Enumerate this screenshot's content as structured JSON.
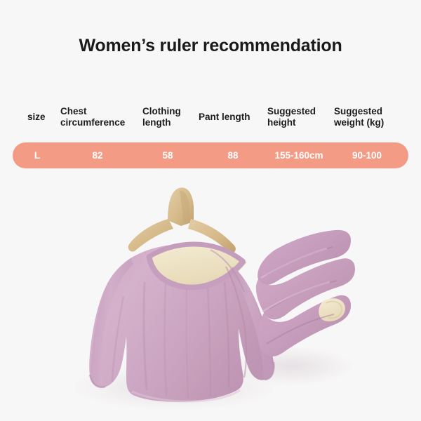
{
  "page": {
    "background_color": "#f8f7f7",
    "title": "Women’s ruler recommendation"
  },
  "size_table": {
    "accent_color": "#f49b85",
    "header_text_color": "#1d1d1d",
    "row_text_color": "#ffffff",
    "columns": [
      {
        "key": "size",
        "label": "size"
      },
      {
        "key": "chest",
        "label": "Chest circumference"
      },
      {
        "key": "clothing",
        "label": "Clothing length"
      },
      {
        "key": "pant",
        "label": "Pant length"
      },
      {
        "key": "height",
        "label": "Suggested height"
      },
      {
        "key": "weight",
        "label": "Suggested weight (kg)"
      }
    ],
    "headers": {
      "size": "size",
      "chest_line1": "Chest",
      "chest_line2": "circumference",
      "clothing_line1": "Clothing",
      "clothing_line2": "length",
      "pant": "Pant length",
      "height_line1": "Suggested",
      "height_line2": "height",
      "weight_line1": "Suggested",
      "weight_line2": "weight (kg)"
    },
    "rows": [
      {
        "size": "L",
        "chest": "82",
        "clothing": "58",
        "pant": "88",
        "height": "155-160cm",
        "weight": "90-100"
      }
    ]
  },
  "product_photo": {
    "alt": "Mauve long-sleeve thermal top on a wooden hanger beside folded matching pants",
    "garment_color": "#cfa9c6",
    "garment_shadow_color": "#b88fb0",
    "garment_highlight_color": "#ddc0d6",
    "lining_color": "#efe6c8",
    "hanger_color": "#d9bf93",
    "hanger_shadow_color": "#c3a775",
    "collar_label_color": "#5a5145",
    "items": [
      {
        "name": "long-sleeve-top",
        "color": "#cfa9c6"
      },
      {
        "name": "folded-pants",
        "color": "#cfa9c6"
      },
      {
        "name": "wooden-hanger",
        "color": "#d9bf93"
      }
    ]
  }
}
